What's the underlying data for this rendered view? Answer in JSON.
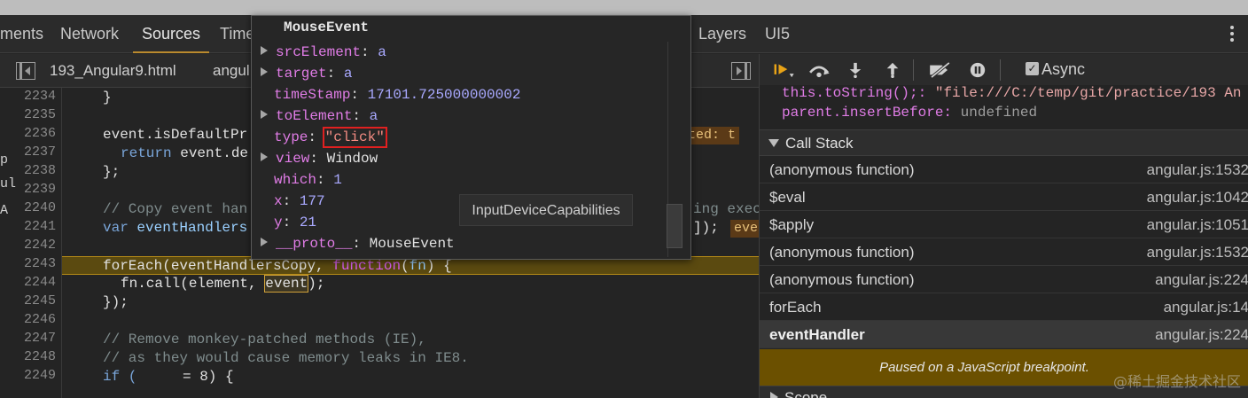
{
  "tabs": [
    {
      "label": "ments"
    },
    {
      "label": "Network"
    },
    {
      "label": "Sources"
    },
    {
      "label": "Time"
    },
    {
      "label": "Layers"
    },
    {
      "label": "UI5"
    }
  ],
  "files": {
    "file1": "193_Angular9.html",
    "file2": "angul"
  },
  "editor": {
    "left_clip": [
      "p",
      "ul",
      "A"
    ],
    "line_numbers": [
      "2234",
      "2235",
      "2236",
      "2237",
      "2238",
      "2239",
      "2240",
      "2241",
      "2242",
      "2243",
      "2244",
      "2245",
      "2246",
      "2247",
      "2248",
      "2249"
    ],
    "lines": {
      "l2234": "}",
      "l2236_a": "event.isDefaultPr",
      "l2236_anno": "ted: t",
      "l2237_a": "return",
      "l2237_b": " event.de",
      "l2238": "};",
      "l2240_a": "// Copy event han",
      "l2240_b": "ing exec",
      "l2241_kw": "var",
      "l2241_var": " eventHandlers",
      "l2241_end": "]);",
      "l2241_chip": "eve",
      "l2243_a": "forEach(eventHandlersCopy, ",
      "l2243_fn": "function",
      "l2243_b": "(",
      "l2243_p": "fn",
      "l2243_c": ") {",
      "l2244_a": "fn.call(element, ",
      "l2244_ev": "event",
      "l2244_b": ");",
      "l2245": "});",
      "l2247": "// Remove monkey-patched methods (IE),",
      "l2248": "// as they would cause memory leaks in IE8.",
      "l2249_a": "if (",
      "l2249_b": "= 8) {"
    }
  },
  "popup": {
    "title": "MouseEvent",
    "props": [
      {
        "key": "srcElement",
        "value": "a",
        "expandable": true,
        "kind": "blue"
      },
      {
        "key": "target",
        "value": "a",
        "expandable": true,
        "kind": "blue"
      },
      {
        "key": "timeStamp",
        "value": "17101.725000000002",
        "expandable": false,
        "kind": "num"
      },
      {
        "key": "toElement",
        "value": "a",
        "expandable": true,
        "kind": "blue"
      },
      {
        "key": "type",
        "value": "\"click\"",
        "expandable": false,
        "kind": "str"
      },
      {
        "key": "view",
        "value": "Window",
        "expandable": true,
        "kind": "obj"
      },
      {
        "key": "which",
        "value": "1",
        "expandable": false,
        "kind": "num"
      },
      {
        "key": "x",
        "value": "177",
        "expandable": false,
        "kind": "num"
      },
      {
        "key": "y",
        "value": "21",
        "expandable": false,
        "kind": "num"
      },
      {
        "key": "__proto__",
        "value": "MouseEvent",
        "expandable": true,
        "kind": "obj"
      }
    ],
    "tooltip": "InputDeviceCapabilities"
  },
  "debugger": {
    "async_label": "Async",
    "async_checked": true,
    "scope_lines": [
      {
        "key": "this.toString();:",
        "value": " \"file:///C:/temp/git/practice/193 An"
      },
      {
        "key": "parent.insertBefore:",
        "value": " undefined"
      }
    ],
    "call_stack_label": "Call Stack",
    "frames": [
      {
        "fn": "(anonymous function)",
        "loc": "angular.js:1532",
        "selected": false
      },
      {
        "fn": "$eval",
        "loc": "angular.js:1042",
        "selected": false
      },
      {
        "fn": "$apply",
        "loc": "angular.js:1051",
        "selected": false
      },
      {
        "fn": "(anonymous function)",
        "loc": "angular.js:1532",
        "selected": false
      },
      {
        "fn": "(anonymous function)",
        "loc": "angular.js:224",
        "selected": false
      },
      {
        "fn": "forEach",
        "loc": "angular.js:14",
        "selected": false
      },
      {
        "fn": "eventHandler",
        "loc": "angular.js:224",
        "selected": true
      }
    ],
    "paused_msg": "Paused on a JavaScript breakpoint.",
    "scope_label": "Scope"
  },
  "watermark": "@稀土掘金技术社区",
  "colors": {
    "accent": "#ba8a2e",
    "paused_bg": "#6b5000",
    "highlight_line": "#5b4a10",
    "string_box": "#e02020"
  }
}
